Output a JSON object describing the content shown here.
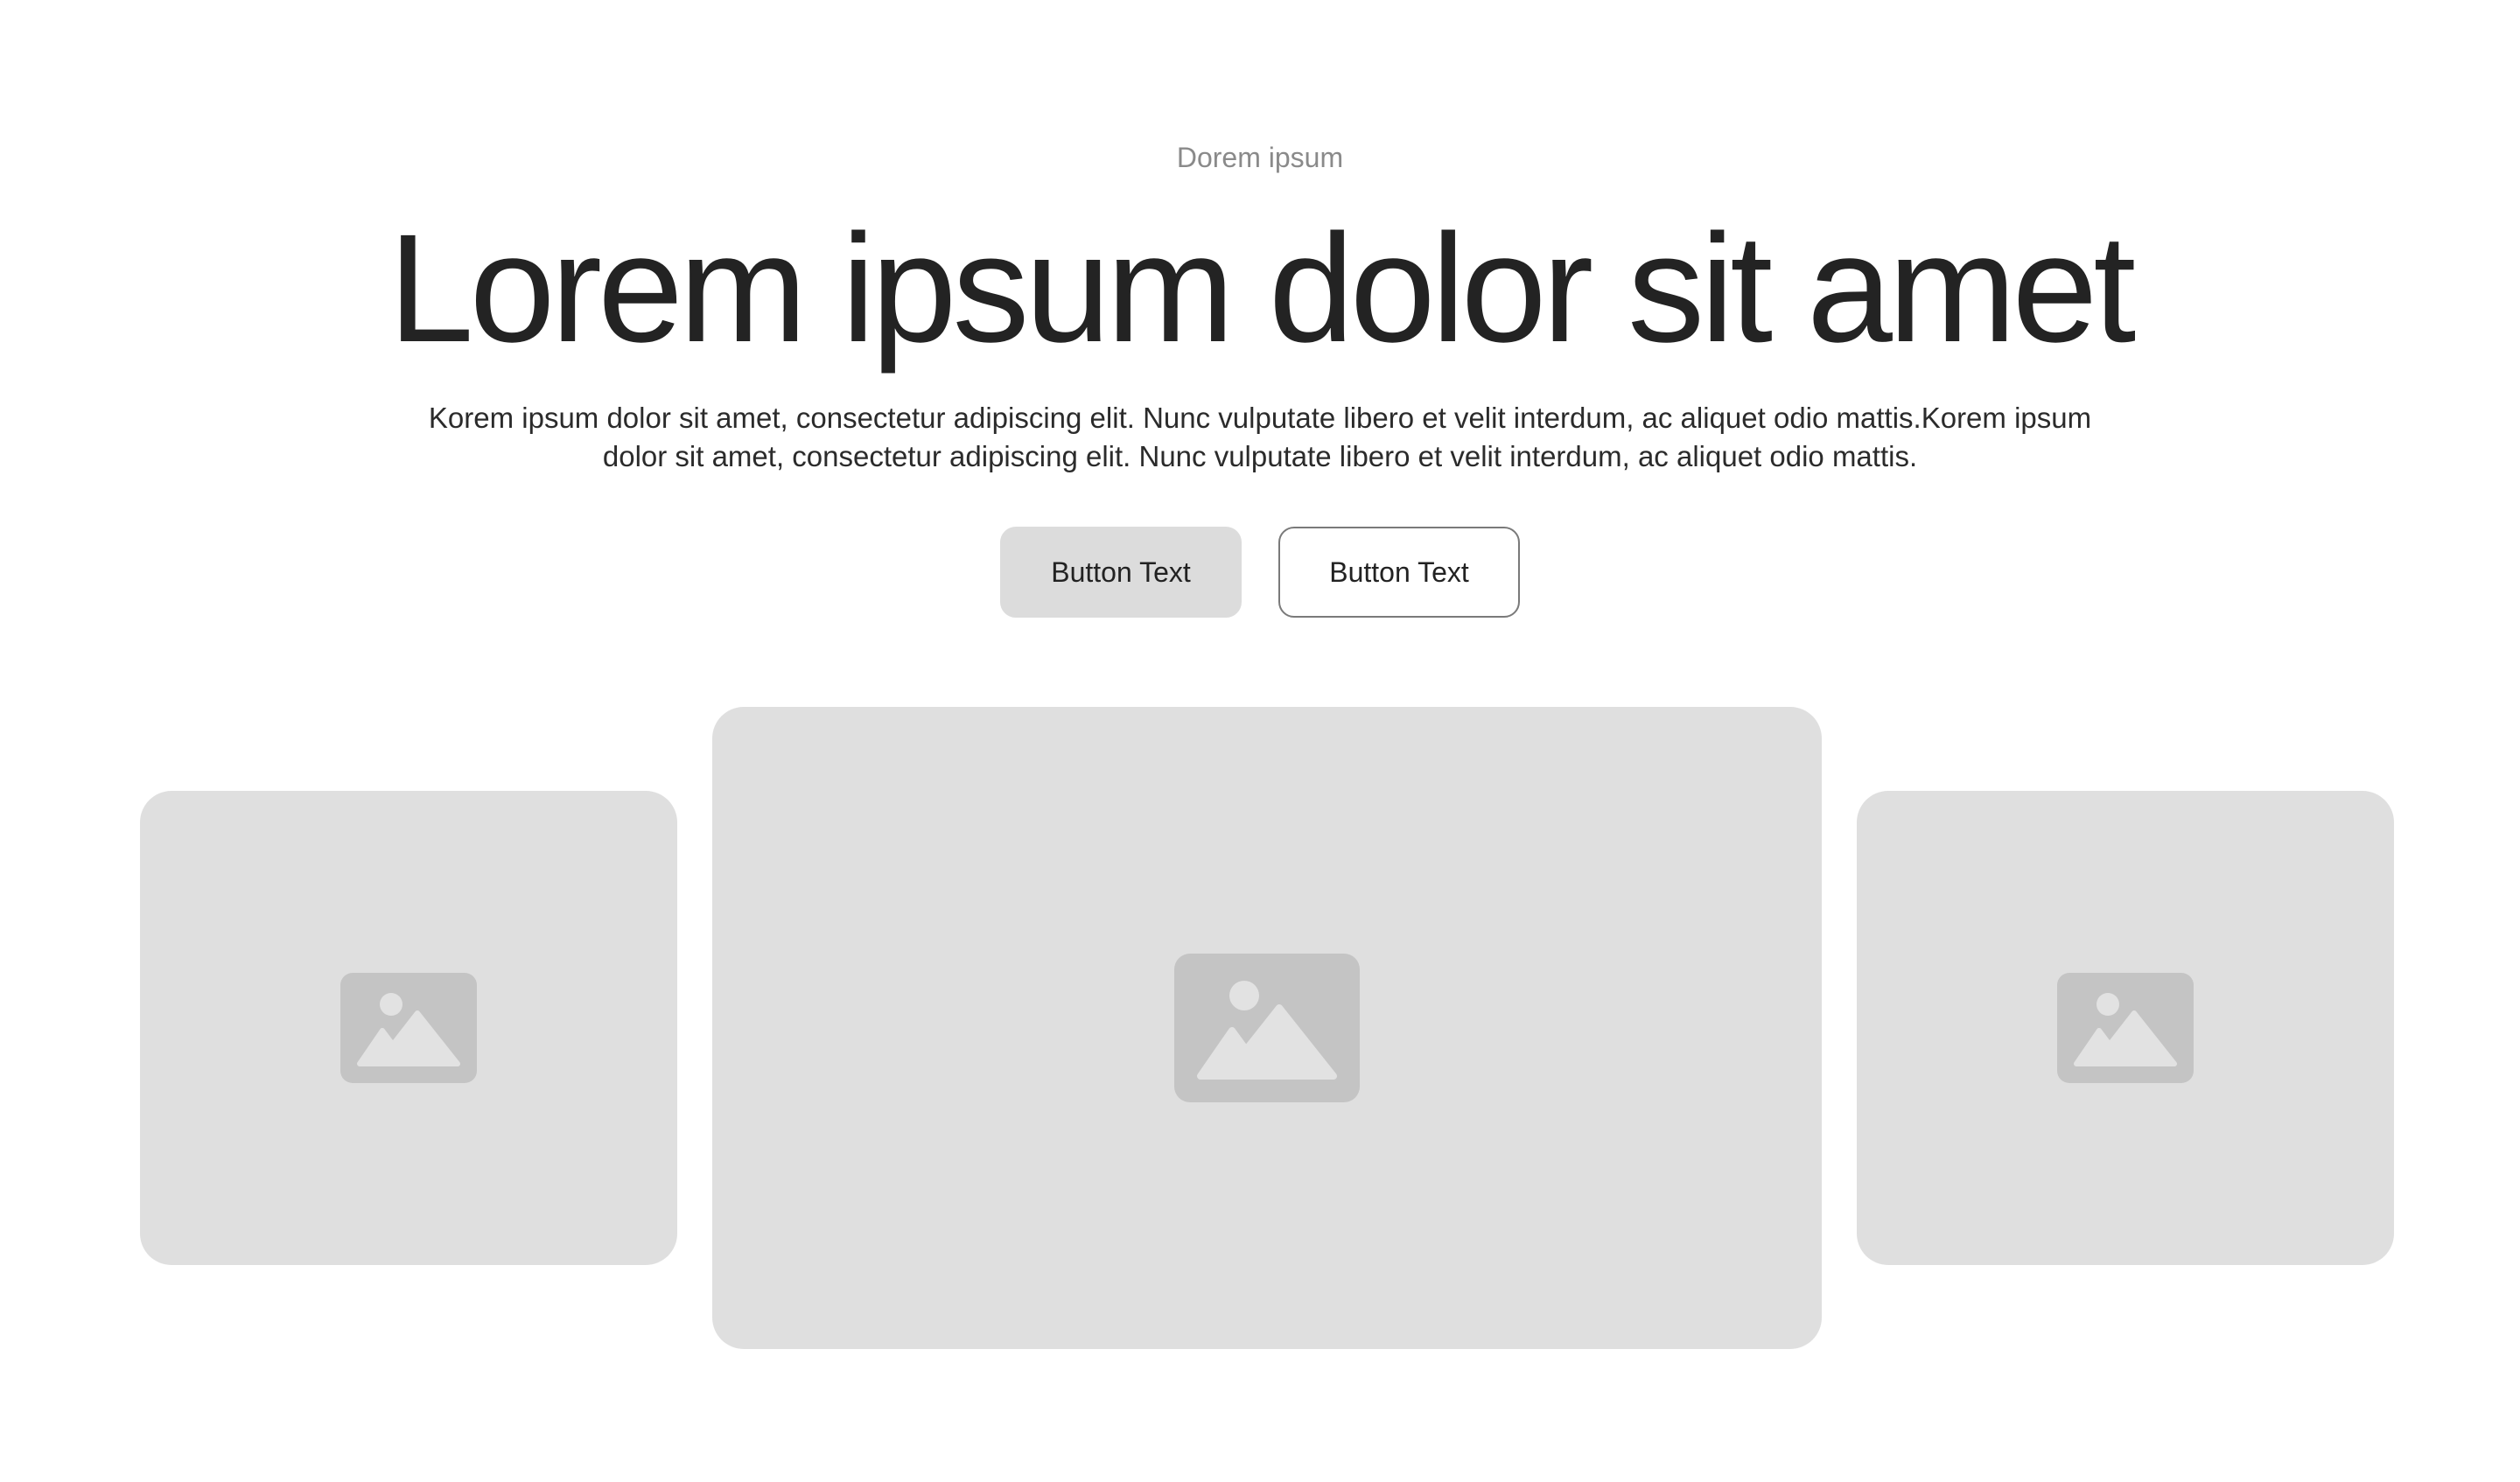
{
  "hero": {
    "eyebrow": "Dorem ipsum",
    "headline": "Lorem ipsum dolor sit amet",
    "body": "Korem ipsum dolor sit amet, consectetur adipiscing elit. Nunc vulputate libero et velit interdum, ac aliquet odio mattis.Korem ipsum dolor sit amet, consectetur adipiscing elit. Nunc vulputate libero et velit interdum, ac aliquet odio mattis."
  },
  "actions": {
    "primary_label": "Button Text",
    "secondary_label": "Button Text"
  },
  "gallery": {
    "items": [
      {
        "icon": "image-placeholder-icon"
      },
      {
        "icon": "image-placeholder-icon"
      },
      {
        "icon": "image-placeholder-icon"
      }
    ]
  },
  "colors": {
    "background": "#ffffff",
    "headline": "#232323",
    "eyebrow": "#8a8a8a",
    "placeholder": "#dfdfdf",
    "placeholder_icon": "#c4c4c4",
    "primary_button": "#dcdcdc",
    "secondary_button_border": "#7a7a7a"
  }
}
